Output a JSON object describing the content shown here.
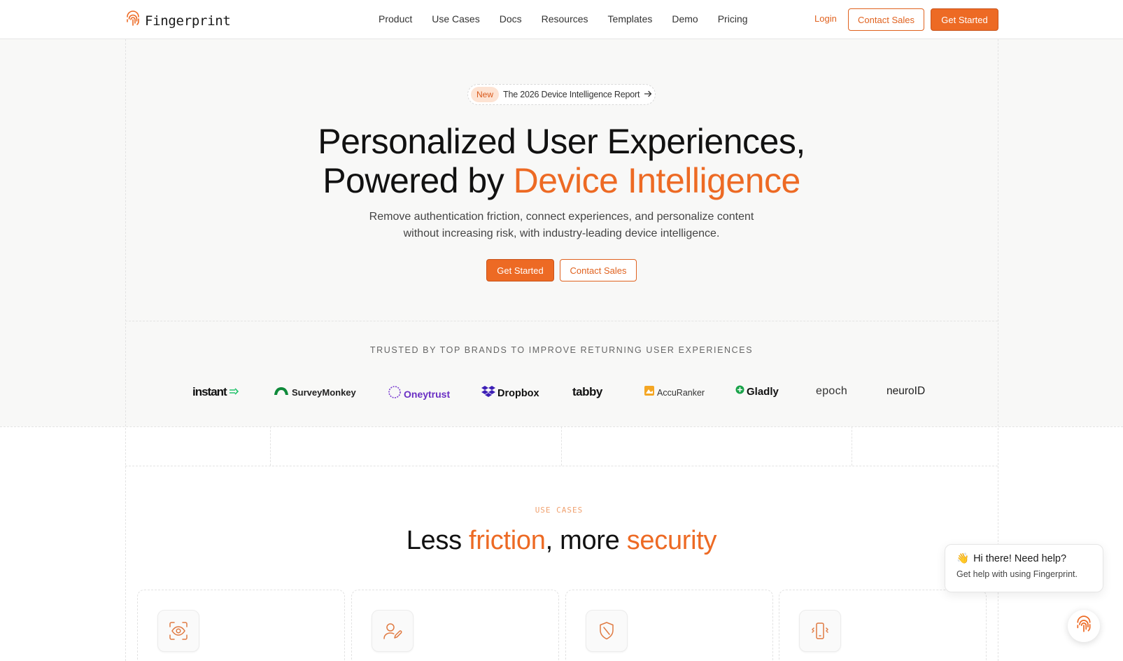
{
  "nav": {
    "logo_text": "Fingerprint",
    "links": [
      "Product",
      "Use Cases",
      "Docs",
      "Resources",
      "Templates",
      "Demo",
      "Pricing"
    ],
    "login": "Login",
    "contact_sales": "Contact Sales",
    "get_started": "Get Started"
  },
  "hero": {
    "badge": "New",
    "announcement": "The 2026 Device Intelligence Report",
    "title_line1": "Personalized User Experiences,",
    "title_line2_prefix": "Powered by ",
    "title_line2_accent": "Device Intelligence",
    "subtitle_line1": "Remove authentication friction, connect experiences, and personalize content",
    "subtitle_line2": "without increasing risk, with industry-leading device intelligence.",
    "get_started": "Get Started",
    "contact_sales": "Contact Sales"
  },
  "trusted": {
    "label": "TRUSTED BY TOP BRANDS TO IMPROVE RETURNING USER EXPERIENCES",
    "brands": [
      "instant",
      "SurveyMonkey",
      "Oneytrust",
      "Dropbox",
      "tabby",
      "AccuRanker",
      "Gladly",
      "epoch",
      "neuroID"
    ]
  },
  "use_cases": {
    "label": "USE CASES",
    "title_1": "Less ",
    "title_2": "friction",
    "title_3": ", more ",
    "title_4": "security",
    "cards": [
      {
        "icon": "eye-scan-icon"
      },
      {
        "icon": "user-edit-icon"
      },
      {
        "icon": "shield-icon"
      },
      {
        "icon": "phone-vibrate-icon"
      }
    ]
  },
  "chat": {
    "emoji": "👋",
    "title": "Hi there! Need help?",
    "subtitle": "Get help with using Fingerprint."
  },
  "colors": {
    "accent": "#ed6a24",
    "accent_light": "#fde3d3",
    "hero_bg": "#f8f8f7"
  }
}
